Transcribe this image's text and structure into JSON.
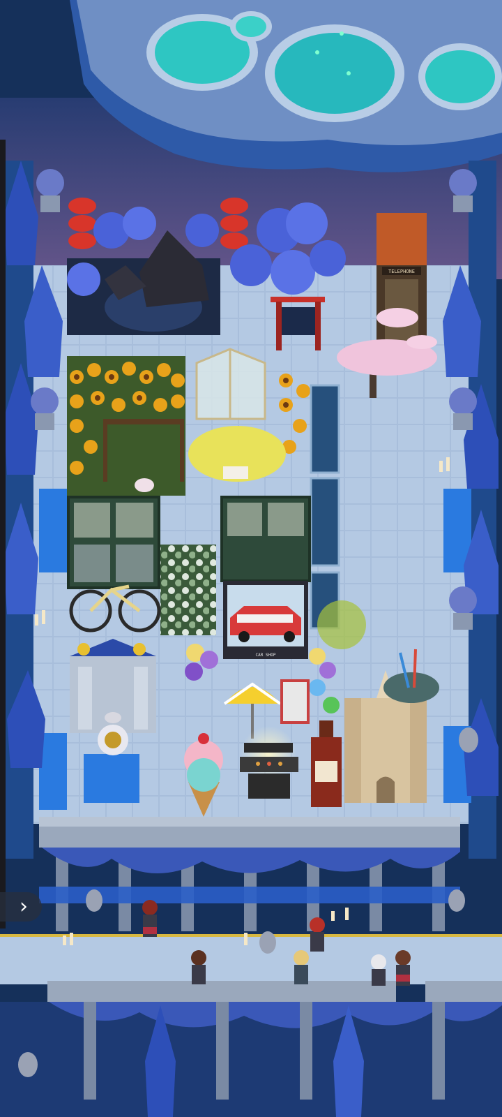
{
  "game": {
    "view": "top-down pixel-art island garden",
    "signs": {
      "phone_booth": "TELEPHONE",
      "display_case": "CAR SHOP"
    }
  },
  "ui": {
    "side_panel_toggle": {
      "icon": "chevron-right-icon",
      "glyph": "›"
    }
  },
  "colors": {
    "night_water": "#15305a",
    "floor_tile": "#9fb7d6",
    "pool_glow": "#2ec6c2",
    "sunflower": "#e8a21a",
    "wisteria": "#4a62d8",
    "lantern_red": "#d8352a",
    "sakura": "#f0c4dc"
  },
  "characters": [
    {
      "role": "villager",
      "hair": "dark red"
    },
    {
      "role": "villager",
      "hair": "brown"
    },
    {
      "role": "villager",
      "hair": "red"
    },
    {
      "role": "villager",
      "hair": "blonde"
    },
    {
      "role": "villager",
      "hair": "white"
    },
    {
      "role": "villager",
      "hair": "brown"
    }
  ]
}
